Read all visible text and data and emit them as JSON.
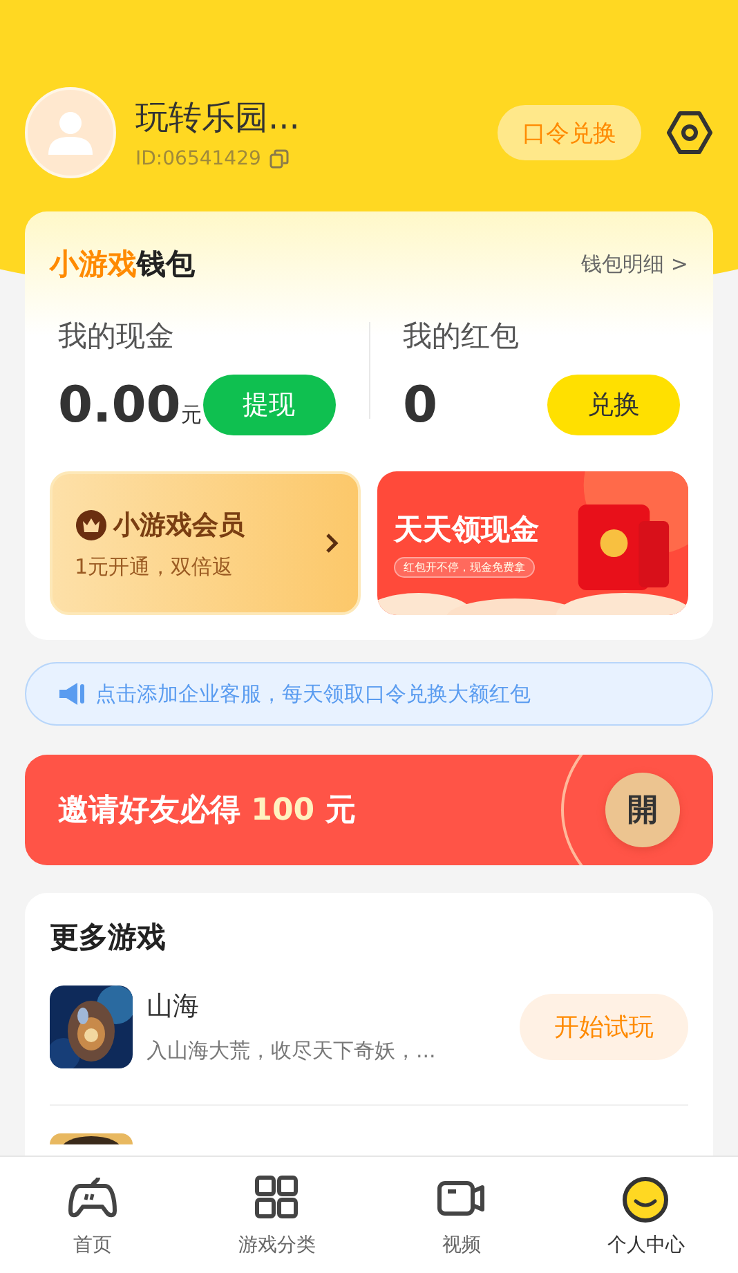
{
  "profile": {
    "name": "玩转乐园...",
    "id": "ID:06541429",
    "code_button": "口令兑换"
  },
  "wallet": {
    "title_highlight": "小游戏",
    "title_rest": "钱包",
    "detail_link": "钱包明细 >",
    "cash": {
      "label": "我的现金",
      "amount": "0.00",
      "unit": "元",
      "button": "提现"
    },
    "redpacket": {
      "label": "我的红包",
      "amount": "0",
      "button": "兑换"
    },
    "member": {
      "title": "小游戏会员",
      "subtitle": "1元开通，双倍返"
    },
    "banner": {
      "title": "天天领现金",
      "subtitle": "红包开不停，现金免费拿"
    }
  },
  "notice": "点击添加企业客服，每天领取口令兑换大额红包",
  "invite": {
    "text": "邀请好友必得",
    "amount": "100",
    "unit": "元",
    "open_button": "開"
  },
  "more_games": {
    "title": "更多游戏",
    "games": [
      {
        "kind": "full",
        "name": "山海",
        "desc": "入山海大荒，收尽天下奇妖，...",
        "button": "开始试玩"
      },
      {
        "kind": "partial"
      }
    ]
  },
  "nav": [
    {
      "label": "首页",
      "selected": false
    },
    {
      "label": "游戏分类",
      "selected": false
    },
    {
      "label": "视频",
      "selected": false
    },
    {
      "label": "个人中心",
      "selected": true
    }
  ]
}
